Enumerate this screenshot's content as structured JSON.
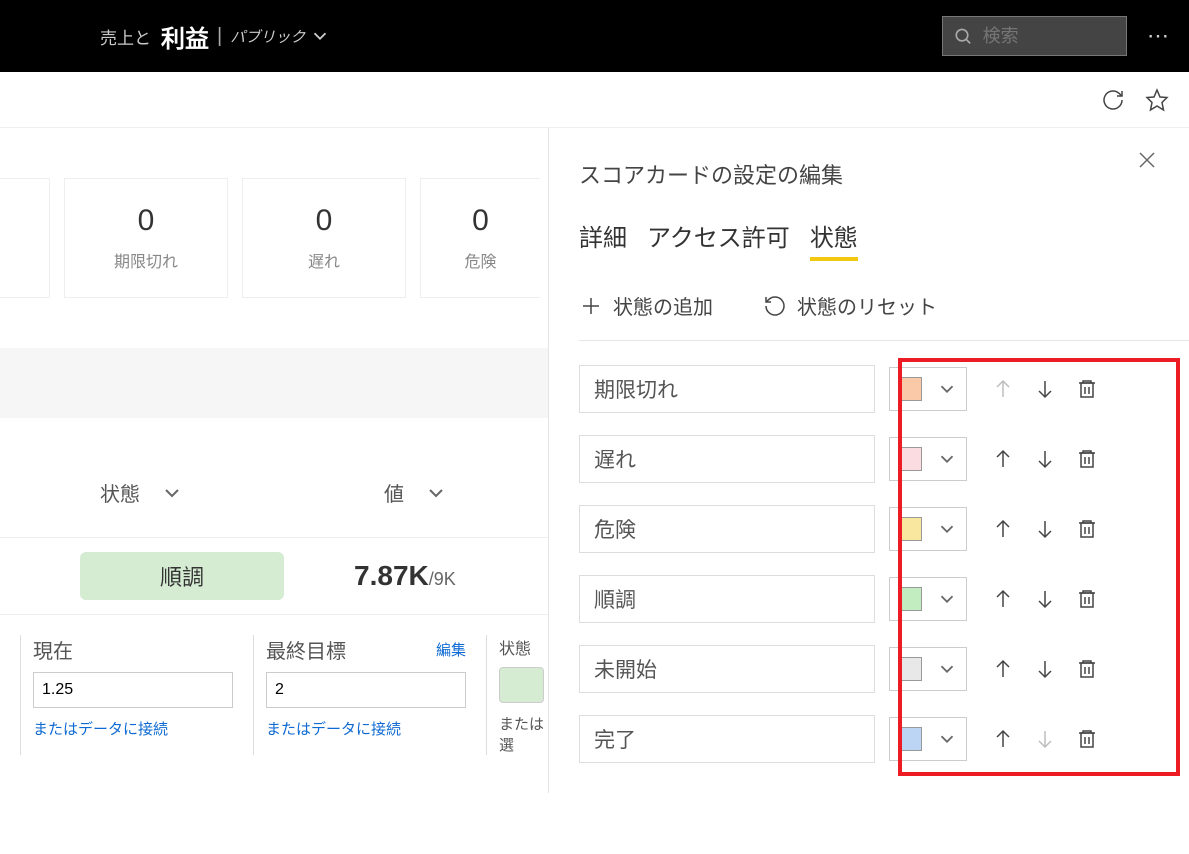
{
  "header": {
    "pre": "売上と",
    "main": "利益",
    "pub": "パブリック",
    "search_placeholder": "検索"
  },
  "cards": [
    {
      "value": "0",
      "label": "期限切れ"
    },
    {
      "value": "0",
      "label": "遅れ"
    },
    {
      "value": "0",
      "label": "危険"
    }
  ],
  "columns": {
    "state": "状態",
    "value": "値"
  },
  "row": {
    "status": "順調",
    "value": "7.87K",
    "suffix": "/9K"
  },
  "edit": {
    "current": "現在",
    "goal": "最終目標",
    "edit_link": "編集",
    "current_val": "1.25",
    "goal_val": "2",
    "connect": "またはデータに接続",
    "state_label": "状態",
    "or_select": "または選"
  },
  "panel": {
    "title": "スコアカードの設定の編集",
    "tabs": [
      "詳細",
      "アクセス許可",
      "状態"
    ],
    "add": "状態の追加",
    "reset": "状態のリセット",
    "statuses": [
      {
        "label": "期限切れ",
        "color": "#f9c9a8",
        "up_disabled": true,
        "down_disabled": false
      },
      {
        "label": "遅れ",
        "color": "#fbdce0",
        "up_disabled": false,
        "down_disabled": false
      },
      {
        "label": "危険",
        "color": "#f9e79f",
        "up_disabled": false,
        "down_disabled": false
      },
      {
        "label": "順調",
        "color": "#c2edc0",
        "up_disabled": false,
        "down_disabled": false
      },
      {
        "label": "未開始",
        "color": "#e8e8e8",
        "up_disabled": false,
        "down_disabled": false
      },
      {
        "label": "完了",
        "color": "#bcd5f5",
        "up_disabled": false,
        "down_disabled": true
      }
    ]
  }
}
